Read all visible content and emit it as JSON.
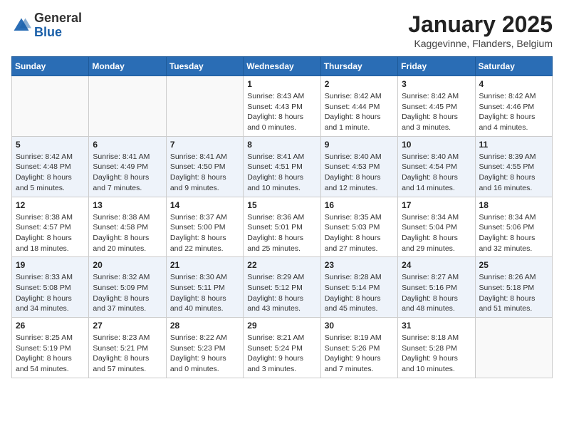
{
  "logo": {
    "general": "General",
    "blue": "Blue"
  },
  "title": "January 2025",
  "location": "Kaggevinne, Flanders, Belgium",
  "weekdays": [
    "Sunday",
    "Monday",
    "Tuesday",
    "Wednesday",
    "Thursday",
    "Friday",
    "Saturday"
  ],
  "weeks": [
    [
      {
        "day": "",
        "info": ""
      },
      {
        "day": "",
        "info": ""
      },
      {
        "day": "",
        "info": ""
      },
      {
        "day": "1",
        "info": "Sunrise: 8:43 AM\nSunset: 4:43 PM\nDaylight: 8 hours\nand 0 minutes."
      },
      {
        "day": "2",
        "info": "Sunrise: 8:42 AM\nSunset: 4:44 PM\nDaylight: 8 hours\nand 1 minute."
      },
      {
        "day": "3",
        "info": "Sunrise: 8:42 AM\nSunset: 4:45 PM\nDaylight: 8 hours\nand 3 minutes."
      },
      {
        "day": "4",
        "info": "Sunrise: 8:42 AM\nSunset: 4:46 PM\nDaylight: 8 hours\nand 4 minutes."
      }
    ],
    [
      {
        "day": "5",
        "info": "Sunrise: 8:42 AM\nSunset: 4:48 PM\nDaylight: 8 hours\nand 5 minutes."
      },
      {
        "day": "6",
        "info": "Sunrise: 8:41 AM\nSunset: 4:49 PM\nDaylight: 8 hours\nand 7 minutes."
      },
      {
        "day": "7",
        "info": "Sunrise: 8:41 AM\nSunset: 4:50 PM\nDaylight: 8 hours\nand 9 minutes."
      },
      {
        "day": "8",
        "info": "Sunrise: 8:41 AM\nSunset: 4:51 PM\nDaylight: 8 hours\nand 10 minutes."
      },
      {
        "day": "9",
        "info": "Sunrise: 8:40 AM\nSunset: 4:53 PM\nDaylight: 8 hours\nand 12 minutes."
      },
      {
        "day": "10",
        "info": "Sunrise: 8:40 AM\nSunset: 4:54 PM\nDaylight: 8 hours\nand 14 minutes."
      },
      {
        "day": "11",
        "info": "Sunrise: 8:39 AM\nSunset: 4:55 PM\nDaylight: 8 hours\nand 16 minutes."
      }
    ],
    [
      {
        "day": "12",
        "info": "Sunrise: 8:38 AM\nSunset: 4:57 PM\nDaylight: 8 hours\nand 18 minutes."
      },
      {
        "day": "13",
        "info": "Sunrise: 8:38 AM\nSunset: 4:58 PM\nDaylight: 8 hours\nand 20 minutes."
      },
      {
        "day": "14",
        "info": "Sunrise: 8:37 AM\nSunset: 5:00 PM\nDaylight: 8 hours\nand 22 minutes."
      },
      {
        "day": "15",
        "info": "Sunrise: 8:36 AM\nSunset: 5:01 PM\nDaylight: 8 hours\nand 25 minutes."
      },
      {
        "day": "16",
        "info": "Sunrise: 8:35 AM\nSunset: 5:03 PM\nDaylight: 8 hours\nand 27 minutes."
      },
      {
        "day": "17",
        "info": "Sunrise: 8:34 AM\nSunset: 5:04 PM\nDaylight: 8 hours\nand 29 minutes."
      },
      {
        "day": "18",
        "info": "Sunrise: 8:34 AM\nSunset: 5:06 PM\nDaylight: 8 hours\nand 32 minutes."
      }
    ],
    [
      {
        "day": "19",
        "info": "Sunrise: 8:33 AM\nSunset: 5:08 PM\nDaylight: 8 hours\nand 34 minutes."
      },
      {
        "day": "20",
        "info": "Sunrise: 8:32 AM\nSunset: 5:09 PM\nDaylight: 8 hours\nand 37 minutes."
      },
      {
        "day": "21",
        "info": "Sunrise: 8:30 AM\nSunset: 5:11 PM\nDaylight: 8 hours\nand 40 minutes."
      },
      {
        "day": "22",
        "info": "Sunrise: 8:29 AM\nSunset: 5:12 PM\nDaylight: 8 hours\nand 43 minutes."
      },
      {
        "day": "23",
        "info": "Sunrise: 8:28 AM\nSunset: 5:14 PM\nDaylight: 8 hours\nand 45 minutes."
      },
      {
        "day": "24",
        "info": "Sunrise: 8:27 AM\nSunset: 5:16 PM\nDaylight: 8 hours\nand 48 minutes."
      },
      {
        "day": "25",
        "info": "Sunrise: 8:26 AM\nSunset: 5:18 PM\nDaylight: 8 hours\nand 51 minutes."
      }
    ],
    [
      {
        "day": "26",
        "info": "Sunrise: 8:25 AM\nSunset: 5:19 PM\nDaylight: 8 hours\nand 54 minutes."
      },
      {
        "day": "27",
        "info": "Sunrise: 8:23 AM\nSunset: 5:21 PM\nDaylight: 8 hours\nand 57 minutes."
      },
      {
        "day": "28",
        "info": "Sunrise: 8:22 AM\nSunset: 5:23 PM\nDaylight: 9 hours\nand 0 minutes."
      },
      {
        "day": "29",
        "info": "Sunrise: 8:21 AM\nSunset: 5:24 PM\nDaylight: 9 hours\nand 3 minutes."
      },
      {
        "day": "30",
        "info": "Sunrise: 8:19 AM\nSunset: 5:26 PM\nDaylight: 9 hours\nand 7 minutes."
      },
      {
        "day": "31",
        "info": "Sunrise: 8:18 AM\nSunset: 5:28 PM\nDaylight: 9 hours\nand 10 minutes."
      },
      {
        "day": "",
        "info": ""
      }
    ]
  ]
}
